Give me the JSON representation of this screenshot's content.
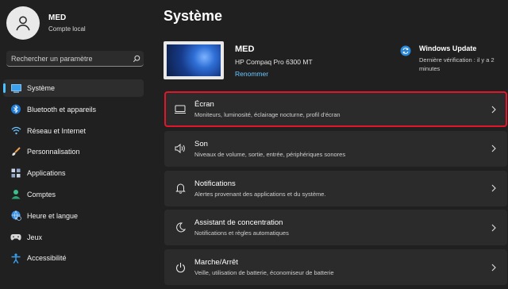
{
  "user": {
    "name": "MED",
    "account_type": "Compte local"
  },
  "search": {
    "placeholder": "Rechercher un paramètre"
  },
  "nav": {
    "items": [
      {
        "label": "Système",
        "icon": "display-icon"
      },
      {
        "label": "Bluetooth et appareils",
        "icon": "bluetooth-icon"
      },
      {
        "label": "Réseau et Internet",
        "icon": "wifi-icon"
      },
      {
        "label": "Personnalisation",
        "icon": "brush-icon"
      },
      {
        "label": "Applications",
        "icon": "apps-icon"
      },
      {
        "label": "Comptes",
        "icon": "accounts-icon"
      },
      {
        "label": "Heure et langue",
        "icon": "globe-clock-icon"
      },
      {
        "label": "Jeux",
        "icon": "gamepad-icon"
      },
      {
        "label": "Accessibilité",
        "icon": "accessibility-icon"
      }
    ]
  },
  "main": {
    "title": "Système",
    "device": {
      "name": "MED",
      "model": "HP Compaq Pro 6300 MT",
      "rename_label": "Renommer"
    },
    "windows_update": {
      "title": "Windows Update",
      "status": "Dernière vérification : il y a 2 minutes"
    },
    "cards": [
      {
        "title": "Écran",
        "desc": "Moniteurs, luminosité, éclairage nocturne, profil d'écran",
        "icon": "monitor-icon"
      },
      {
        "title": "Son",
        "desc": "Niveaux de volume, sortie, entrée, périphériques sonores",
        "icon": "speaker-icon"
      },
      {
        "title": "Notifications",
        "desc": "Alertes provenant des applications et du système.",
        "icon": "bell-icon"
      },
      {
        "title": "Assistant de concentration",
        "desc": "Notifications et règles automatiques",
        "icon": "moon-icon"
      },
      {
        "title": "Marche/Arrêt",
        "desc": "Veille, utilisation de batterie, économiseur de batterie",
        "icon": "power-icon"
      }
    ]
  },
  "colors": {
    "accent": "#4cc2ff",
    "highlight_border": "#e0162b",
    "background": "#202020",
    "card": "#2b2b2b"
  }
}
